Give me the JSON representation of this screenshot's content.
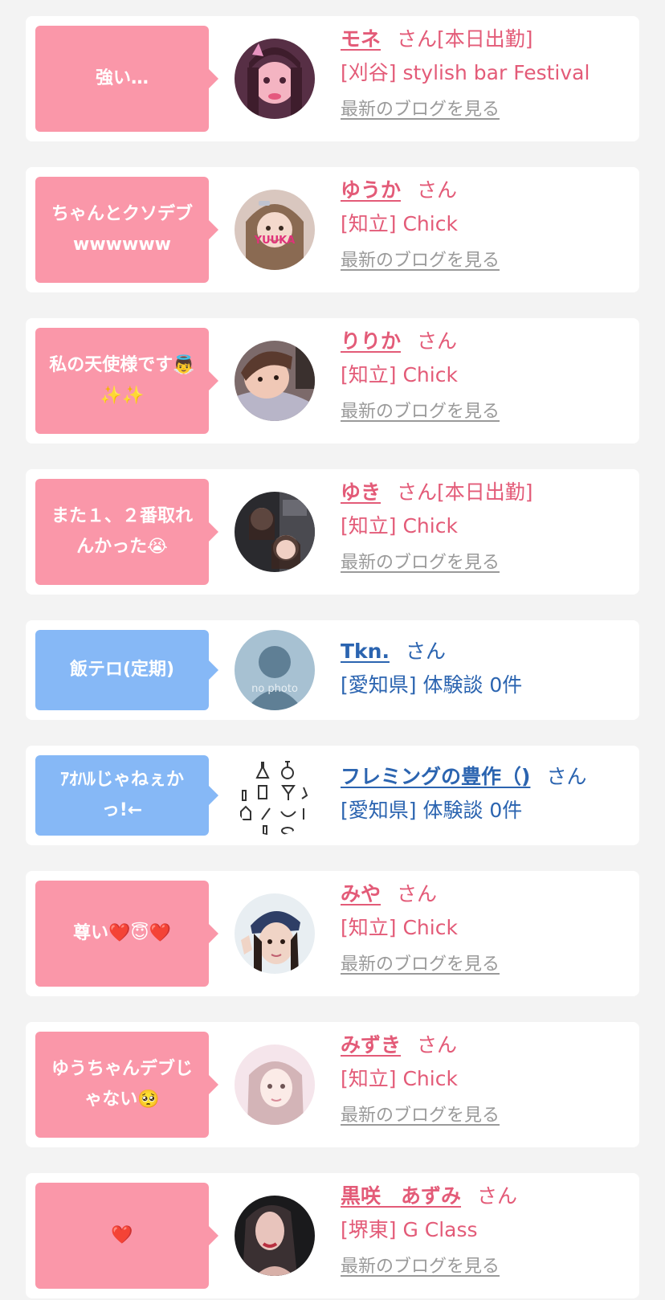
{
  "colors": {
    "pink_bubble": "#fa97a9",
    "blue_bubble": "#86b8f6",
    "pink_text": "#e35b78",
    "blue_text": "#2b64b0",
    "blog_link": "#9a9a9a"
  },
  "cards": [
    {
      "type": "girl",
      "comment": "強い…",
      "name": "モネ",
      "honorific": "さん[本日出勤]",
      "shop": "[刈谷] stylish bar Festival",
      "blog_link": "最新のブログを見る"
    },
    {
      "type": "girl",
      "comment": "ちゃんとクソデブ\nwwwwww",
      "name": "ゆうか",
      "honorific": "さん",
      "shop": "[知立] Chick",
      "blog_link": "最新のブログを見る",
      "avatar_text": "YUUKA"
    },
    {
      "type": "girl",
      "comment": "私の天使様です👼\n✨✨",
      "name": "りりか",
      "honorific": "さん",
      "shop": "[知立] Chick",
      "blog_link": "最新のブログを見る"
    },
    {
      "type": "girl",
      "comment": "また１、２番取れ\nんかった😭",
      "name": "ゆき",
      "honorific": "さん[本日出勤]",
      "shop": "[知立] Chick",
      "blog_link": "最新のブログを見る"
    },
    {
      "type": "user",
      "comment": "飯テロ(定期)",
      "name": "Tkn.",
      "honorific": "さん",
      "shop": "[愛知県] 体験談 0件",
      "avatar_text": "no photo"
    },
    {
      "type": "user",
      "comment": "ｱｵﾊﾙじゃねぇか\nっ!←",
      "name": "フレミングの豊作（)",
      "honorific": "さん",
      "shop": "[愛知県] 体験談 0件"
    },
    {
      "type": "girl",
      "comment": "尊い❤️😇❤️",
      "name": "みや",
      "honorific": "さん",
      "shop": "[知立] Chick",
      "blog_link": "最新のブログを見る"
    },
    {
      "type": "girl",
      "comment": "ゆうちゃんデブじ\nゃない🥺",
      "name": "みずき",
      "honorific": "さん",
      "shop": "[知立] Chick",
      "blog_link": "最新のブログを見る"
    },
    {
      "type": "girl",
      "comment": "❤️",
      "name": "黒咲　あずみ",
      "honorific": "さん",
      "shop": "[堺東] G Class",
      "blog_link": "最新のブログを見る"
    }
  ]
}
